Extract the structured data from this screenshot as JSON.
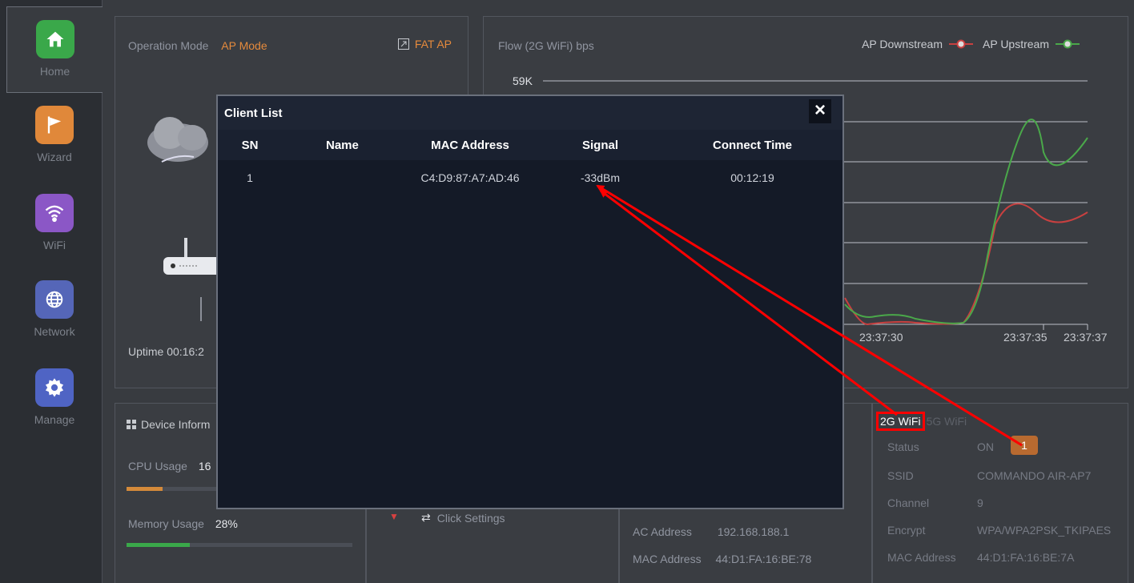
{
  "sidebar": {
    "items": [
      {
        "label": "Home",
        "icon": "home-icon"
      },
      {
        "label": "Wizard",
        "icon": "flag-icon"
      },
      {
        "label": "WiFi",
        "icon": "wifi-icon"
      },
      {
        "label": "Network",
        "icon": "globe-icon"
      },
      {
        "label": "Manage",
        "icon": "gear-icon"
      }
    ]
  },
  "top_left": {
    "op_mode_label": "Operation Mode",
    "op_mode_value": "AP Mode",
    "fat_ap": "FAT AP",
    "uptime": "Uptime 00:16:2"
  },
  "flow": {
    "title": "Flow (2G WiFi) bps",
    "legend_down": "AP Downstream",
    "legend_up": "AP Upstream",
    "y_top": "59K",
    "x_labels": [
      "23:37:30",
      "23:37:35",
      "23:37:37"
    ]
  },
  "device": {
    "title": "Device Inform",
    "cpu_label": "CPU Usage",
    "cpu_value": "16",
    "cpu_percent": 16,
    "mem_label": "Memory Usage",
    "mem_value": "28%",
    "mem_percent": 28
  },
  "middle": {
    "click_settings": "Click Settings",
    "ac_address_label": "AC Address",
    "ac_address_value": "192.168.188.1",
    "mac_label": "MAC Address",
    "mac_value": "44:D1:FA:16:BE:78"
  },
  "wifi_panel": {
    "tab_2g": "2G WiFi",
    "tab_5g": "5G WiFi",
    "status_label": "Status",
    "status_value": "ON",
    "client_count": "1",
    "ssid_label": "SSID",
    "ssid_value": "COMMANDO AIR-AP7",
    "channel_label": "Channel",
    "channel_value": "9",
    "encrypt_label": "Encrypt",
    "encrypt_value": "WPA/WPA2PSK_TKIPAES",
    "mac_label": "MAC Address",
    "mac_value": "44:D1:FA:16:BE:7A"
  },
  "modal": {
    "title": "Client List",
    "close": "×",
    "headers": [
      "SN",
      "Name",
      "MAC Address",
      "Signal",
      "Connect Time"
    ],
    "rows": [
      [
        "1",
        "",
        "C4:D9:87:A7:AD:46",
        "-33dBm",
        "00:12:19"
      ]
    ]
  },
  "colors": {
    "downstream": "#c84040",
    "upstream": "#4aa84a",
    "annotation": "#ff0000",
    "accent": "#e58a3c"
  }
}
